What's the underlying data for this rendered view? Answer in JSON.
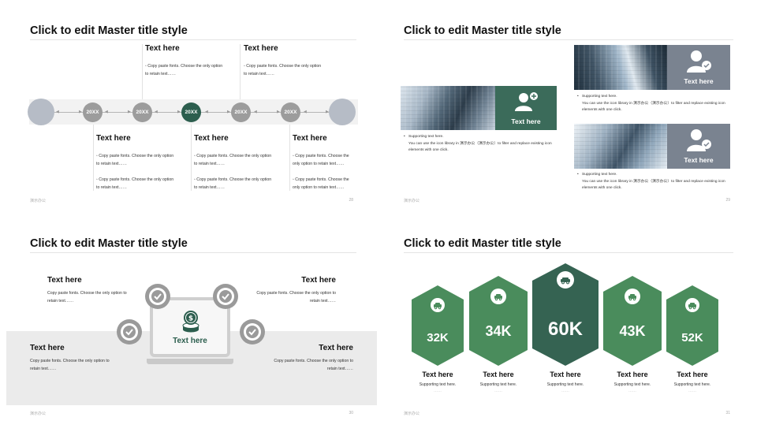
{
  "common": {
    "title": "Click to edit Master title style",
    "footer": "演示办公",
    "text_here": "Text here",
    "copy_paste": "Copy paste fonts. Choose the only option to retain text……"
  },
  "slide1": {
    "page": "28",
    "nodes": [
      "20XX",
      "20XX",
      "20XX",
      "20XX",
      "20XX"
    ],
    "top_items": [
      {
        "heading": "Text here",
        "line1": "Copy paste fonts. Choose the only option",
        "line2": "to retain text……"
      },
      {
        "heading": "Text here",
        "line1": "Copy paste fonts. Choose the only option",
        "line2": "to retain text……"
      }
    ],
    "bottom_items": [
      {
        "heading": "Text here",
        "a1": "Copy paste fonts. Choose the only option",
        "a2": "to retain text……",
        "b1": "Copy paste fonts. Choose the only option",
        "b2": "to retain text……"
      },
      {
        "heading": "Text here",
        "a1": "Copy paste fonts. Choose the only option",
        "a2": "to retain text……",
        "b1": "Copy paste fonts. Choose the only option",
        "b2": "to retain text……"
      },
      {
        "heading": "Text here",
        "a1": "Copy paste fonts. Choose the",
        "a2": "only option to retain text……",
        "b1": "Copy paste fonts. Choose the",
        "b2": "only option to retain text……"
      }
    ]
  },
  "slide2": {
    "page": "29",
    "panels": [
      {
        "label": "Text here",
        "b1": "Supporting text here.",
        "b2": "You can use the icon library in 演示办公（演示办公）to filter and replace existing icon",
        "b3": "elements with one click."
      },
      {
        "label": "Text here",
        "b1": "Supporting text here.",
        "b2": "You can use the icon library in 演示办公（演示办公）to filter and replace existing icon",
        "b3": "elements with one click."
      },
      {
        "label": "Text here",
        "b1": "Supporting text here.",
        "b2": "You can use the icon library in 演示办公（演示办公）to filter and replace existing icon",
        "b3": "elements with one click."
      }
    ],
    "colors": {
      "green": "#3b6b5a",
      "slate": "#7a8390"
    }
  },
  "slide3": {
    "page": "30",
    "center_label": "Text here",
    "items": [
      {
        "heading": "Text here",
        "line1": "Copy paste fonts. Choose the only option to",
        "line2": "retain text……"
      },
      {
        "heading": "Text here",
        "line1": "Copy paste fonts. Choose the only option to",
        "line2": "retain text……"
      },
      {
        "heading": "Text here",
        "line1": "Copy paste fonts. Choose the only option to",
        "line2": "retain text……"
      },
      {
        "heading": "Text here",
        "line1": "Copy paste fonts. Choose the only option to",
        "line2": "retain text……"
      }
    ]
  },
  "slide4": {
    "page": "31",
    "hexes": [
      {
        "value": "32K",
        "heading": "Text here",
        "sub": "Supporting text here.",
        "dash": "……"
      },
      {
        "value": "34K",
        "heading": "Text here",
        "sub": "Supporting text here.",
        "dash": "……"
      },
      {
        "value": "60K",
        "heading": "Text here",
        "sub": "Supporting text here.",
        "dash": "……"
      },
      {
        "value": "43K",
        "heading": "Text here",
        "sub": "Supporting text here.",
        "dash": "……"
      },
      {
        "value": "52K",
        "heading": "Text here",
        "sub": "Supporting text here.",
        "dash": "……"
      }
    ],
    "colors": {
      "green": "#4a8c5c",
      "dark": "#356352"
    }
  }
}
